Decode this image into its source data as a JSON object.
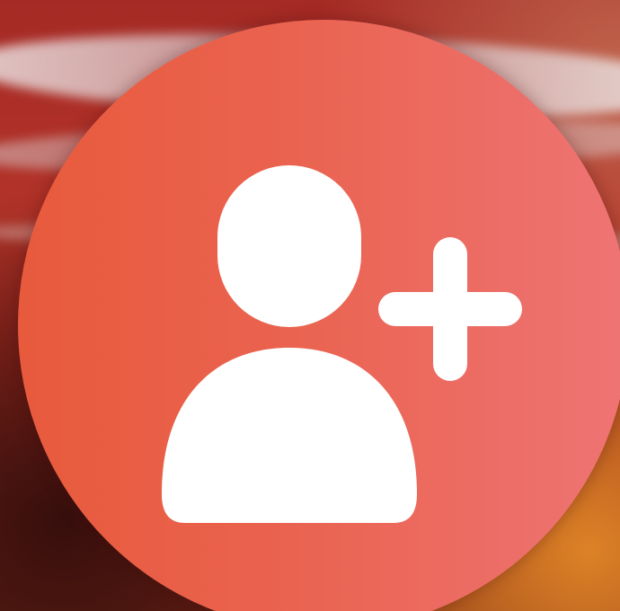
{
  "wallpaper": {
    "description_icon": "abstract-light-streaks"
  },
  "add_contact_button": {
    "icon": "person-add-icon",
    "background_colors": [
      "#e85a3c",
      "#ee7474"
    ],
    "icon_color": "#ffffff"
  }
}
